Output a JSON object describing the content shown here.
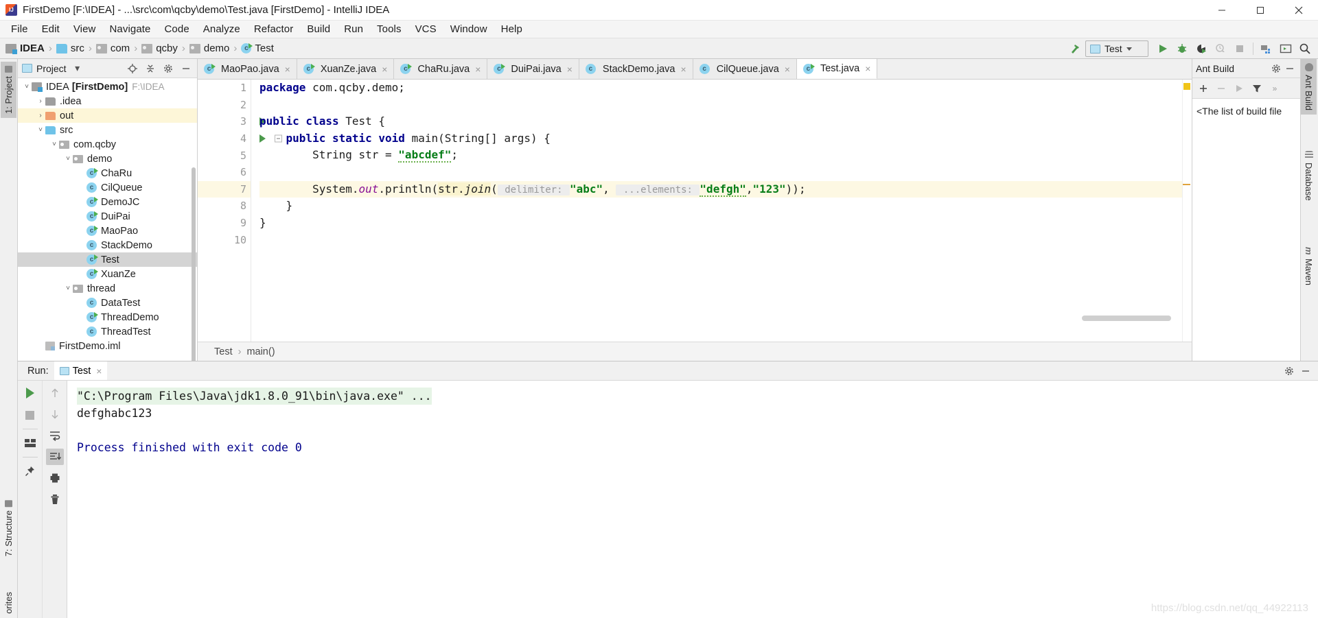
{
  "window": {
    "title": "FirstDemo [F:\\IDEA] - ...\\src\\com\\qcby\\demo\\Test.java [FirstDemo] - IntelliJ IDEA",
    "minimize_label": "minimize-icon",
    "maximize_label": "maximize-icon",
    "close_label": "close-icon"
  },
  "menubar": {
    "items": [
      "File",
      "Edit",
      "View",
      "Navigate",
      "Code",
      "Analyze",
      "Refactor",
      "Build",
      "Run",
      "Tools",
      "VCS",
      "Window",
      "Help"
    ]
  },
  "navbar": {
    "crumbs": [
      {
        "label": "IDEA",
        "icon": "module-icon",
        "bold": true
      },
      {
        "label": "src",
        "icon": "source-folder-icon",
        "bold": false
      },
      {
        "label": "com",
        "icon": "package-icon",
        "bold": false
      },
      {
        "label": "qcby",
        "icon": "package-icon",
        "bold": false
      },
      {
        "label": "demo",
        "icon": "package-icon",
        "bold": false
      },
      {
        "label": "Test",
        "icon": "java-class-icon",
        "bold": false
      }
    ],
    "separator": "›",
    "run_config": "Test",
    "buttons": [
      "hammer-build-icon",
      "run-icon",
      "debug-icon",
      "run-with-coverage-icon",
      "profile-icon",
      "stop-icon",
      "project-structure-icon",
      "terminal-icon",
      "search-icon"
    ]
  },
  "left_strip": {
    "project": "1: Project",
    "structure": "7: Structure",
    "favorites": "orites"
  },
  "project_panel": {
    "title": "Project",
    "dropdown": "▾",
    "header_buttons": [
      "locate-icon",
      "collapse-all-icon",
      "settings-gear-icon",
      "hide-icon"
    ],
    "tree": [
      {
        "label": "IDEA",
        "bold_label": "[FirstDemo]",
        "path": "F:\\IDEA",
        "indent": 0,
        "arrow": "˅",
        "icon": "module-icon",
        "state": "normal"
      },
      {
        "label": ".idea",
        "indent": 1,
        "arrow": "›",
        "icon": "folder-gray-icon",
        "state": "normal"
      },
      {
        "label": "out",
        "indent": 1,
        "arrow": "›",
        "icon": "folder-orange-icon",
        "state": "highlight"
      },
      {
        "label": "src",
        "indent": 1,
        "arrow": "˅",
        "icon": "folder-source-icon",
        "state": "normal"
      },
      {
        "label": "com.qcby",
        "indent": 2,
        "arrow": "˅",
        "icon": "package-icon",
        "state": "normal"
      },
      {
        "label": "demo",
        "indent": 3,
        "arrow": "˅",
        "icon": "package-icon",
        "state": "normal"
      },
      {
        "label": "ChaRu",
        "indent": 4,
        "arrow": "",
        "icon": "java-class-runnable-icon",
        "state": "normal"
      },
      {
        "label": "CilQueue",
        "indent": 4,
        "arrow": "",
        "icon": "java-class-icon",
        "state": "normal"
      },
      {
        "label": "DemoJC",
        "indent": 4,
        "arrow": "",
        "icon": "java-class-runnable-icon",
        "state": "normal"
      },
      {
        "label": "DuiPai",
        "indent": 4,
        "arrow": "",
        "icon": "java-class-runnable-icon",
        "state": "normal"
      },
      {
        "label": "MaoPao",
        "indent": 4,
        "arrow": "",
        "icon": "java-class-runnable-icon",
        "state": "normal"
      },
      {
        "label": "StackDemo",
        "indent": 4,
        "arrow": "",
        "icon": "java-class-icon",
        "state": "normal"
      },
      {
        "label": "Test",
        "indent": 4,
        "arrow": "",
        "icon": "java-class-runnable-icon",
        "state": "selected"
      },
      {
        "label": "XuanZe",
        "indent": 4,
        "arrow": "",
        "icon": "java-class-runnable-icon",
        "state": "normal"
      },
      {
        "label": "thread",
        "indent": 3,
        "arrow": "˅",
        "icon": "package-icon",
        "state": "normal"
      },
      {
        "label": "DataTest",
        "indent": 4,
        "arrow": "",
        "icon": "java-class-icon",
        "state": "normal"
      },
      {
        "label": "ThreadDemo",
        "indent": 4,
        "arrow": "",
        "icon": "java-class-runnable-icon",
        "state": "normal"
      },
      {
        "label": "ThreadTest",
        "indent": 4,
        "arrow": "",
        "icon": "java-class-icon",
        "state": "normal"
      },
      {
        "label": "FirstDemo.iml",
        "indent": 1,
        "arrow": "",
        "icon": "iml-file-icon",
        "state": "normal"
      }
    ]
  },
  "editor": {
    "tabs": [
      {
        "label": "MaoPao.java",
        "icon": "java-class-runnable-icon",
        "active": false,
        "close": "×"
      },
      {
        "label": "XuanZe.java",
        "icon": "java-class-runnable-icon",
        "active": false,
        "close": "×"
      },
      {
        "label": "ChaRu.java",
        "icon": "java-class-runnable-icon",
        "active": false,
        "close": "×"
      },
      {
        "label": "DuiPai.java",
        "icon": "java-class-runnable-icon",
        "active": false,
        "close": "×"
      },
      {
        "label": "StackDemo.java",
        "icon": "java-class-icon",
        "active": false,
        "close": "×"
      },
      {
        "label": "CilQueue.java",
        "icon": "java-class-icon",
        "active": false,
        "close": "×"
      },
      {
        "label": "Test.java",
        "icon": "java-class-runnable-icon",
        "active": true,
        "close": "×"
      }
    ],
    "line_numbers": [
      "1",
      "2",
      "3",
      "4",
      "5",
      "6",
      "7",
      "8",
      "9",
      "10"
    ],
    "highlighted_line": 7,
    "gutter_run_lines": [
      3,
      4
    ],
    "code_lines": [
      {
        "n": 1,
        "tokens": [
          {
            "t": "package ",
            "c": "kw"
          },
          {
            "t": "com.qcby.demo;",
            "c": ""
          }
        ]
      },
      {
        "n": 2,
        "tokens": []
      },
      {
        "n": 3,
        "tokens": [
          {
            "t": "public class ",
            "c": "kw"
          },
          {
            "t": "Test {",
            "c": ""
          }
        ]
      },
      {
        "n": 4,
        "tokens": [
          {
            "t": "    public static void ",
            "c": "kw"
          },
          {
            "t": "main(String[] args) {",
            "c": ""
          }
        ]
      },
      {
        "n": 5,
        "tokens": [
          {
            "t": "        String str = ",
            "c": ""
          },
          {
            "t": "\"abcdef\"",
            "c": "str wavy"
          },
          {
            "t": ";",
            "c": ""
          }
        ]
      },
      {
        "n": 6,
        "tokens": []
      },
      {
        "n": 7,
        "tokens": [
          {
            "t": "        System.",
            "c": ""
          },
          {
            "t": "out",
            "c": "stat"
          },
          {
            "t": ".println(",
            "c": ""
          },
          {
            "t": "str.",
            "c": "joinhl"
          },
          {
            "t": "join",
            "c": "joinhl mth"
          },
          {
            "t": "(",
            "c": ""
          },
          {
            "t": " delimiter: ",
            "c": "hint"
          },
          {
            "t": "\"abc\"",
            "c": "str"
          },
          {
            "t": ", ",
            "c": ""
          },
          {
            "t": " ...elements: ",
            "c": "hint"
          },
          {
            "t": "\"defgh\"",
            "c": "str wavy"
          },
          {
            "t": ",",
            "c": ""
          },
          {
            "t": "\"123\"",
            "c": "str"
          },
          {
            "t": "));",
            "c": ""
          }
        ]
      },
      {
        "n": 8,
        "tokens": [
          {
            "t": "    }",
            "c": ""
          }
        ]
      },
      {
        "n": 9,
        "tokens": [
          {
            "t": "}",
            "c": ""
          }
        ]
      },
      {
        "n": 10,
        "tokens": []
      }
    ],
    "breadcrumb": [
      "Test",
      "main()"
    ],
    "breadcrumb_sep": "›"
  },
  "right_panel": {
    "title": "Ant Build",
    "header_buttons": [
      "settings-gear-icon",
      "hide-icon"
    ],
    "toolbar": [
      "add-icon",
      "remove-icon",
      "run-icon",
      "filter-icon",
      "more-icon"
    ],
    "empty_text": "<The list of build file"
  },
  "right_strip": {
    "ant_build": "Ant Build",
    "database": "Database",
    "maven": "Maven"
  },
  "run_panel": {
    "label": "Run:",
    "tab": "Test",
    "tab_close": "×",
    "header_buttons": [
      "settings-gear-icon",
      "hide-icon"
    ],
    "toolbar_left": [
      "rerun-icon",
      "stop-icon",
      "layout-icon",
      "pin-icon"
    ],
    "toolbar_right": [
      "up-icon",
      "down-icon",
      "soft-wrap-icon",
      "scroll-to-end-icon",
      "print-icon",
      "clear-all-icon"
    ],
    "console": [
      {
        "text": "\"C:\\Program Files\\Java\\jdk1.8.0_91\\bin\\java.exe\" ...",
        "style": "cmd"
      },
      {
        "text": "defghabc123",
        "style": "out"
      },
      {
        "text": "",
        "style": "out"
      },
      {
        "text": "Process finished with exit code 0",
        "style": "fin"
      }
    ]
  },
  "watermark": "https://blog.csdn.net/qq_44922113",
  "colors": {
    "accent_green": "#4c9a4c",
    "keyword": "#00008c",
    "string": "#067d17",
    "static_field": "#871094",
    "highlight_line": "#fdf8e3",
    "selection": "#d4d4d4"
  }
}
